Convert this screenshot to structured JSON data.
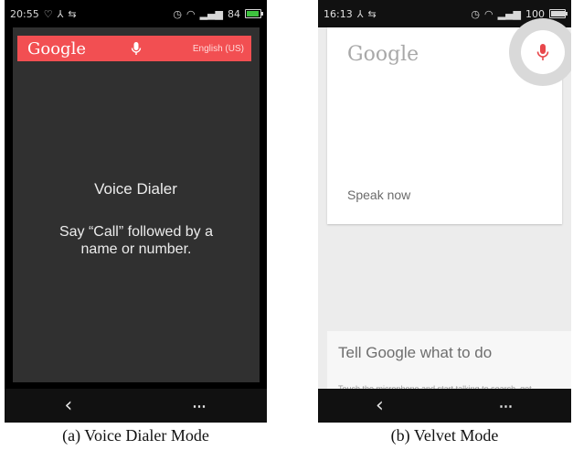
{
  "panel_a": {
    "status": {
      "time": "20:55",
      "battery": "84",
      "battery_level": 0.84
    },
    "google_bar": {
      "logo": "Google",
      "language": "English (US)"
    },
    "voice_dialer": {
      "title": "Voice Dialer",
      "instruction": "Say “Call” followed by a name or number."
    },
    "nav": {
      "back_icon": "chevron-left-icon",
      "menu": "⋯"
    },
    "caption": "(a) Voice Dialer Mode"
  },
  "panel_b": {
    "status": {
      "time": "16:13",
      "battery": "100",
      "battery_level": 1.0
    },
    "card": {
      "logo": "Google",
      "prompt": "Speak now"
    },
    "tell": {
      "heading": "Tell Google what to do",
      "subtext": "Touch the microphone and start talking to search, get"
    },
    "nav": {
      "back_icon": "chevron-left-icon",
      "menu": "⋯"
    },
    "caption": "(b) Velvet Mode"
  },
  "colors": {
    "google_bar": "#f24f52",
    "mic_red": "#e8474b",
    "dark_screen": "#303030",
    "light_screen": "#ececec"
  }
}
